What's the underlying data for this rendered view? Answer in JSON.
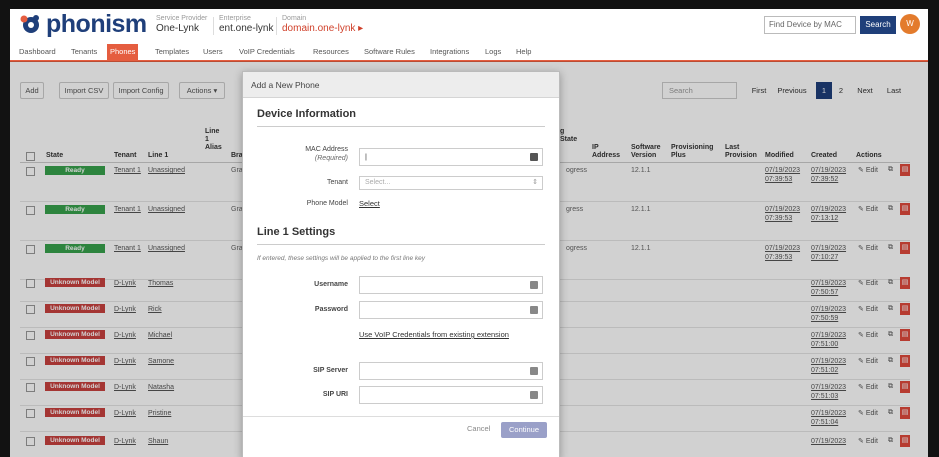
{
  "header": {
    "brand": "phonism",
    "service_provider": {
      "label": "Service Provider",
      "value": "One-Lynk"
    },
    "enterprise": {
      "label": "Enterprise",
      "value": "ent.one-lynk"
    },
    "domain": {
      "label": "Domain",
      "value": "domain.one-lynk ▸"
    },
    "find_placeholder": "Find Device by MAC",
    "search_label": "Search",
    "avatar_initials": "W"
  },
  "nav": [
    "Dashboard",
    "Tenants",
    "Phones",
    "Templates",
    "Users",
    "VoIP Credentials",
    "Resources",
    "Software Rules",
    "Integrations",
    "Logs",
    "Help"
  ],
  "toolbar": {
    "add": "Add",
    "import_csv": "Import CSV",
    "import_config": "Import Config",
    "actions": "Actions ▾",
    "search_placeholder": "Search",
    "first": "First",
    "previous": "Previous",
    "page1": "1",
    "page2": "2",
    "next": "Next",
    "last": "Last"
  },
  "table": {
    "headers": {
      "state": "State",
      "tenant": "Tenant",
      "line1": "Line 1",
      "line1_alias": "Line 1 Alias",
      "brand": "Bra",
      "state2": "g State",
      "ip": "IP Address",
      "software": "Software Version",
      "provisioning": "Provisioning Plus",
      "last_provision": "Last Provision",
      "modified": "Modified",
      "created": "Created",
      "actions": "Actions"
    },
    "rows": [
      {
        "state": "Ready",
        "tenant": "Tenant 1",
        "line1": "Unassigned",
        "brand": "Grai",
        "state2": "ogress",
        "software": "12.1.1",
        "modified": "07/19/2023 07:39:53",
        "created": "07/19/2023 07:39:52"
      },
      {
        "state": "Ready",
        "tenant": "Tenant 1",
        "line1": "Unassigned",
        "brand": "Grai",
        "state2": "gress",
        "software": "12.1.1",
        "modified": "07/19/2023 07:39:53",
        "created": "07/19/2023 07:13:12"
      },
      {
        "state": "Ready",
        "tenant": "Tenant 1",
        "line1": "Unassigned",
        "brand": "Grai",
        "state2": "ogress",
        "software": "12.1.1",
        "modified": "07/19/2023 07:39:53",
        "created": "07/19/2023 07:10:27"
      },
      {
        "state": "Unknown Model",
        "tenant": "D-Lynk",
        "line1": "Thomas",
        "created": "07/19/2023 07:50:57"
      },
      {
        "state": "Unknown Model",
        "tenant": "D-Lynk",
        "line1": "Rick",
        "created": "07/19/2023 07:50:59"
      },
      {
        "state": "Unknown Model",
        "tenant": "D-Lynk",
        "line1": "Michael",
        "created": "07/19/2023 07:51:00"
      },
      {
        "state": "Unknown Model",
        "tenant": "D-Lynk",
        "line1": "Samone",
        "created": "07/19/2023 07:51:02"
      },
      {
        "state": "Unknown Model",
        "tenant": "D-Lynk",
        "line1": "Natasha",
        "created": "07/19/2023 07:51:03"
      },
      {
        "state": "Unknown Model",
        "tenant": "D-Lynk",
        "line1": "Pristine",
        "created": "07/19/2023 07:51:04"
      },
      {
        "state": "Unknown Model",
        "tenant": "D-Lynk",
        "line1": "Shaun",
        "created": "07/19/2023"
      }
    ],
    "edit_label": "Edit"
  },
  "modal": {
    "title": "Add a New Phone",
    "device_section": "Device Information",
    "mac_label": "MAC Address",
    "mac_required": "(Required)",
    "mac_value": "|",
    "tenant_label": "Tenant",
    "tenant_placeholder": "Select...",
    "phone_model_label": "Phone Model",
    "phone_model_link": "Select",
    "line_section": "Line 1 Settings",
    "line_note": "If entered, these settings will be applied to the first line key",
    "username_label": "Username",
    "password_label": "Password",
    "voip_link": "Use VoIP Credentials from existing extension",
    "sip_server_label": "SIP Server",
    "sip_uri_label": "SIP URI",
    "cancel": "Cancel",
    "continue": "Continue"
  }
}
